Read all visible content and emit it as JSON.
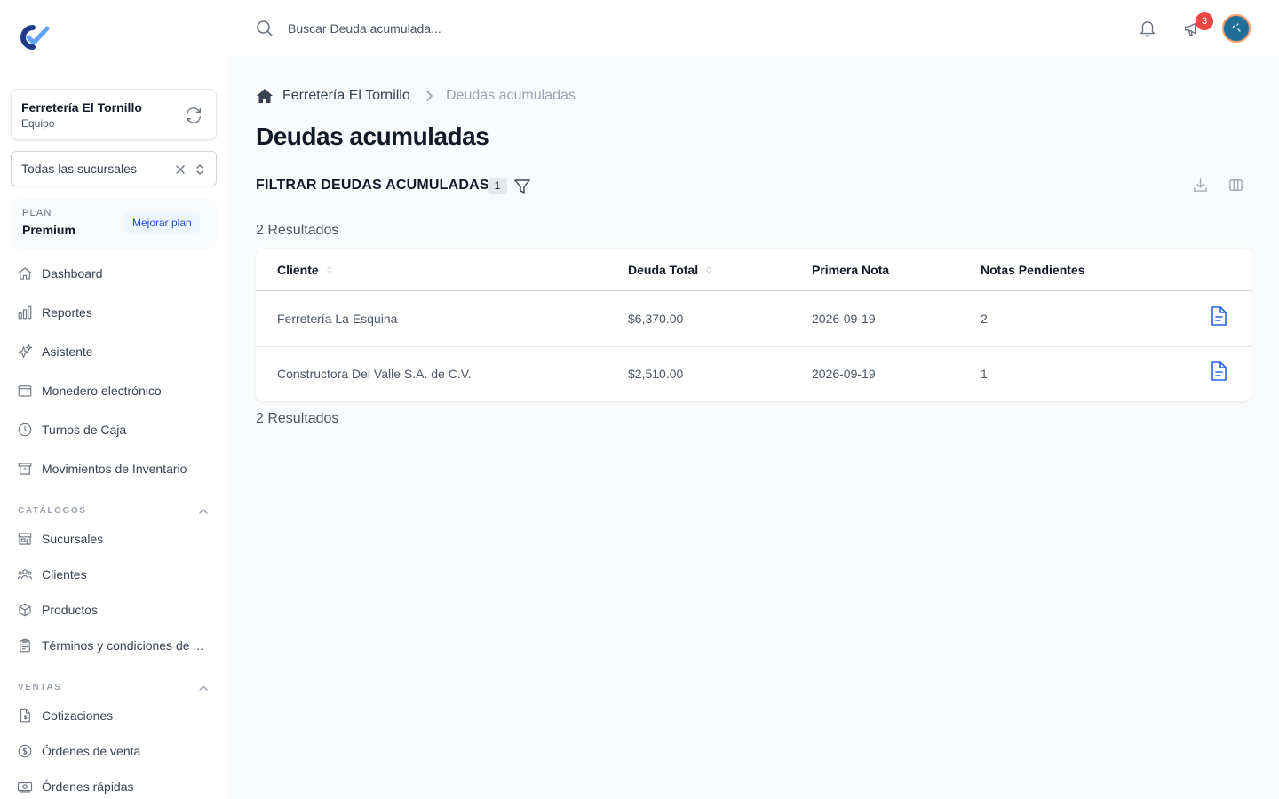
{
  "sidebar": {
    "team": {
      "name": "Ferretería El Tornillo",
      "role": "Equipo"
    },
    "branch_select": {
      "value": "Todas las sucursales"
    },
    "plan": {
      "label": "PLAN",
      "name": "Premium",
      "upgrade_label": "Mejorar plan"
    },
    "nav": [
      {
        "label": "Dashboard",
        "icon": "home-icon"
      },
      {
        "label": "Reportes",
        "icon": "bar-chart-icon"
      },
      {
        "label": "Asistente",
        "icon": "sparkles-icon"
      },
      {
        "label": "Monedero electrónico",
        "icon": "wallet-icon"
      },
      {
        "label": "Turnos de Caja",
        "icon": "clock-icon"
      },
      {
        "label": "Movimientos de Inventario",
        "icon": "archive-box-icon"
      }
    ],
    "sections": [
      {
        "label": "CATÁLOGOS",
        "items": [
          {
            "label": "Sucursales",
            "icon": "storefront-icon"
          },
          {
            "label": "Clientes",
            "icon": "users-icon"
          },
          {
            "label": "Productos",
            "icon": "cube-icon"
          },
          {
            "label": "Términos y condiciones de ...",
            "icon": "clipboard-icon"
          }
        ]
      },
      {
        "label": "VENTAS",
        "items": [
          {
            "label": "Cotizaciones",
            "icon": "document-dollar-icon"
          },
          {
            "label": "Órdenes de venta",
            "icon": "currency-circle-icon"
          },
          {
            "label": "Órdenes rápidas",
            "icon": "banknote-icon"
          }
        ]
      }
    ]
  },
  "topbar": {
    "search_placeholder": "Buscar Deuda acumulada...",
    "notification_count": "3"
  },
  "breadcrumb": {
    "home": "Ferretería El Tornillo",
    "current": "Deudas acumuladas"
  },
  "page": {
    "title": "Deudas acumuladas",
    "filter_title": "FILTRAR DEUDAS ACUMULADAS",
    "filter_count": "1",
    "results_label": "2 Resultados"
  },
  "table": {
    "columns": [
      "Cliente",
      "Deuda Total",
      "Primera Nota",
      "Notas Pendientes"
    ],
    "rows": [
      {
        "cliente": "Ferretería La Esquina",
        "deuda_total": "$6,370.00",
        "primera_nota": "2026-09-19",
        "notas_pendientes": "2"
      },
      {
        "cliente": "Constructora Del Valle S.A. de C.V.",
        "deuda_total": "$2,510.00",
        "primera_nota": "2026-09-19",
        "notas_pendientes": "1"
      }
    ]
  },
  "colors": {
    "accent": "#1d4ed8",
    "icon_blue": "#2563eb",
    "badge_red": "#ef4444"
  }
}
